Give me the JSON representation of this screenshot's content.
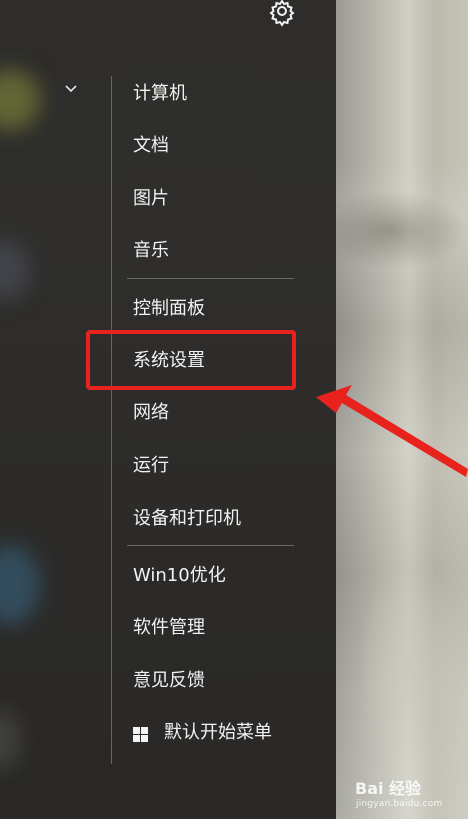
{
  "menu": {
    "top_items": [
      "计算机",
      "文档",
      "图片",
      "音乐"
    ],
    "mid_items": [
      "控制面板",
      "系统设置",
      "网络",
      "运行",
      "设备和打印机"
    ],
    "bottom_items": [
      "Win10优化",
      "软件管理",
      "意见反馈"
    ],
    "default_start_label": "默认开始菜单",
    "highlighted_item": "系统设置"
  },
  "icons": {
    "settings": "gear-icon",
    "collapse": "chevron-down-icon",
    "windows": "windows-logo-icon"
  },
  "annotation": {
    "box_color": "#e8231d",
    "arrow_color": "#e8231d"
  },
  "watermark": {
    "brand": "Bai 经验",
    "url": "jingyan.baidu.com"
  }
}
